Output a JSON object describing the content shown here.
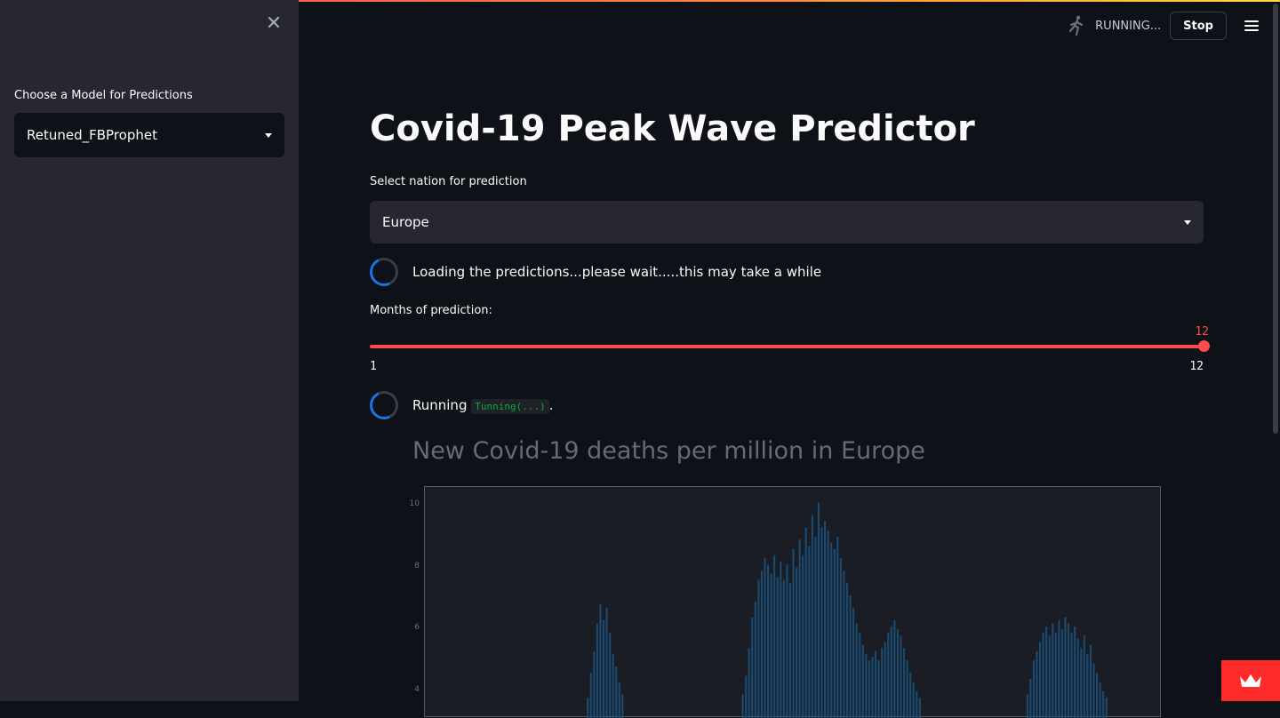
{
  "sidebar": {
    "close_glyph": "✕",
    "model_label": "Choose a Model for Predictions",
    "model_value": "Retuned_FBProphet"
  },
  "header": {
    "status_text": "RUNNING...",
    "stop_label": "Stop"
  },
  "main": {
    "title": "Covid-19 Peak Wave Predictor",
    "nation_label": "Select nation for prediction",
    "nation_value": "Europe",
    "loading_text": "Loading the predictions...please wait.....this may take a while",
    "months_label": "Months of prediction:",
    "slider": {
      "value": "12",
      "min": "1",
      "max": "12"
    },
    "running_text": "Running",
    "running_code": "Tunning(...)",
    "running_suffix": "."
  },
  "chart_data": {
    "type": "bar",
    "title": "New Covid-19 deaths per million in Europe",
    "yticks": [
      "10",
      "8",
      "6",
      "4"
    ],
    "ylim": [
      3.5,
      10.6
    ],
    "color": "#1a4a72",
    "series": [
      {
        "values": [
          0.0,
          0.0,
          0.0,
          0.0,
          0.0,
          0.0,
          0.0,
          0.0,
          0.0,
          0.0,
          0.0,
          0.0,
          0.0,
          0.0,
          0.0,
          0.0,
          0.0,
          0.0,
          0.0,
          0.0,
          0.0,
          0.0,
          0.0,
          0.0,
          0.0,
          0.0,
          0.0,
          0.0,
          0.0,
          0.0,
          0.0,
          0.0,
          0.0,
          0.0,
          0.0,
          0.0,
          0.0,
          0.0,
          0.0,
          0.0,
          0.0,
          0.0,
          0.0,
          0.0,
          0.0,
          0.0,
          0.0,
          0.0,
          0.0,
          0.0,
          0.0,
          3.8,
          4.6,
          5.3,
          6.2,
          6.8,
          6.3,
          6.7,
          5.9,
          5.2,
          4.8,
          4.3,
          3.9,
          0.0,
          0.0,
          0.0,
          0.0,
          0.0,
          0.0,
          0.0,
          0.0,
          0.0,
          0.0,
          0.0,
          0.0,
          0.0,
          0.0,
          0.0,
          0.0,
          0.0,
          0.0,
          0.0,
          0.0,
          0.0,
          0.0,
          0.0,
          0.0,
          0.0,
          0.0,
          0.0,
          0.0,
          0.0,
          0.0,
          0.0,
          0.0,
          0.0,
          0.0,
          0.0,
          0.0,
          0.0,
          3.9,
          4.5,
          5.4,
          6.4,
          6.9,
          7.6,
          7.9,
          8.3,
          8.1,
          7.8,
          8.4,
          7.7,
          8.2,
          7.6,
          8.1,
          7.5,
          8.6,
          8.0,
          8.9,
          8.4,
          9.3,
          8.7,
          9.7,
          9.0,
          10.1,
          9.3,
          9.5,
          9.2,
          8.8,
          8.6,
          9.0,
          8.3,
          7.9,
          7.5,
          7.1,
          6.7,
          6.2,
          5.9,
          5.5,
          5.2,
          5.0,
          5.1,
          5.3,
          5.0,
          5.4,
          5.6,
          5.9,
          6.1,
          6.3,
          6.0,
          5.8,
          5.4,
          5.0,
          4.6,
          4.3,
          4.0,
          3.8,
          0.0,
          0.0,
          0.0,
          0.0,
          0.0,
          0.0,
          0.0,
          0.0,
          0.0,
          0.0,
          0.0,
          0.0,
          0.0,
          0.0,
          0.0,
          0.0,
          0.0,
          0.0,
          0.0,
          0.0,
          0.0,
          0.0,
          0.0,
          0.0,
          0.0,
          0.0,
          0.0,
          0.0,
          0.0,
          0.0,
          0.0,
          0.0,
          0.0,
          3.9,
          4.4,
          5.0,
          5.3,
          5.6,
          5.9,
          6.1,
          5.8,
          6.2,
          5.9,
          6.3,
          6.0,
          6.4,
          6.2,
          5.9,
          6.1,
          5.7,
          5.4,
          5.8,
          5.2,
          5.5,
          4.9,
          4.6,
          4.3,
          4.0,
          3.8,
          0.0,
          0.0,
          0.0,
          0.0,
          0.0,
          0.0,
          0.0,
          0.0,
          0.0,
          0.0,
          0.0,
          0.0,
          0.0,
          0.0,
          0.0,
          0.0,
          0.0
        ]
      }
    ]
  }
}
